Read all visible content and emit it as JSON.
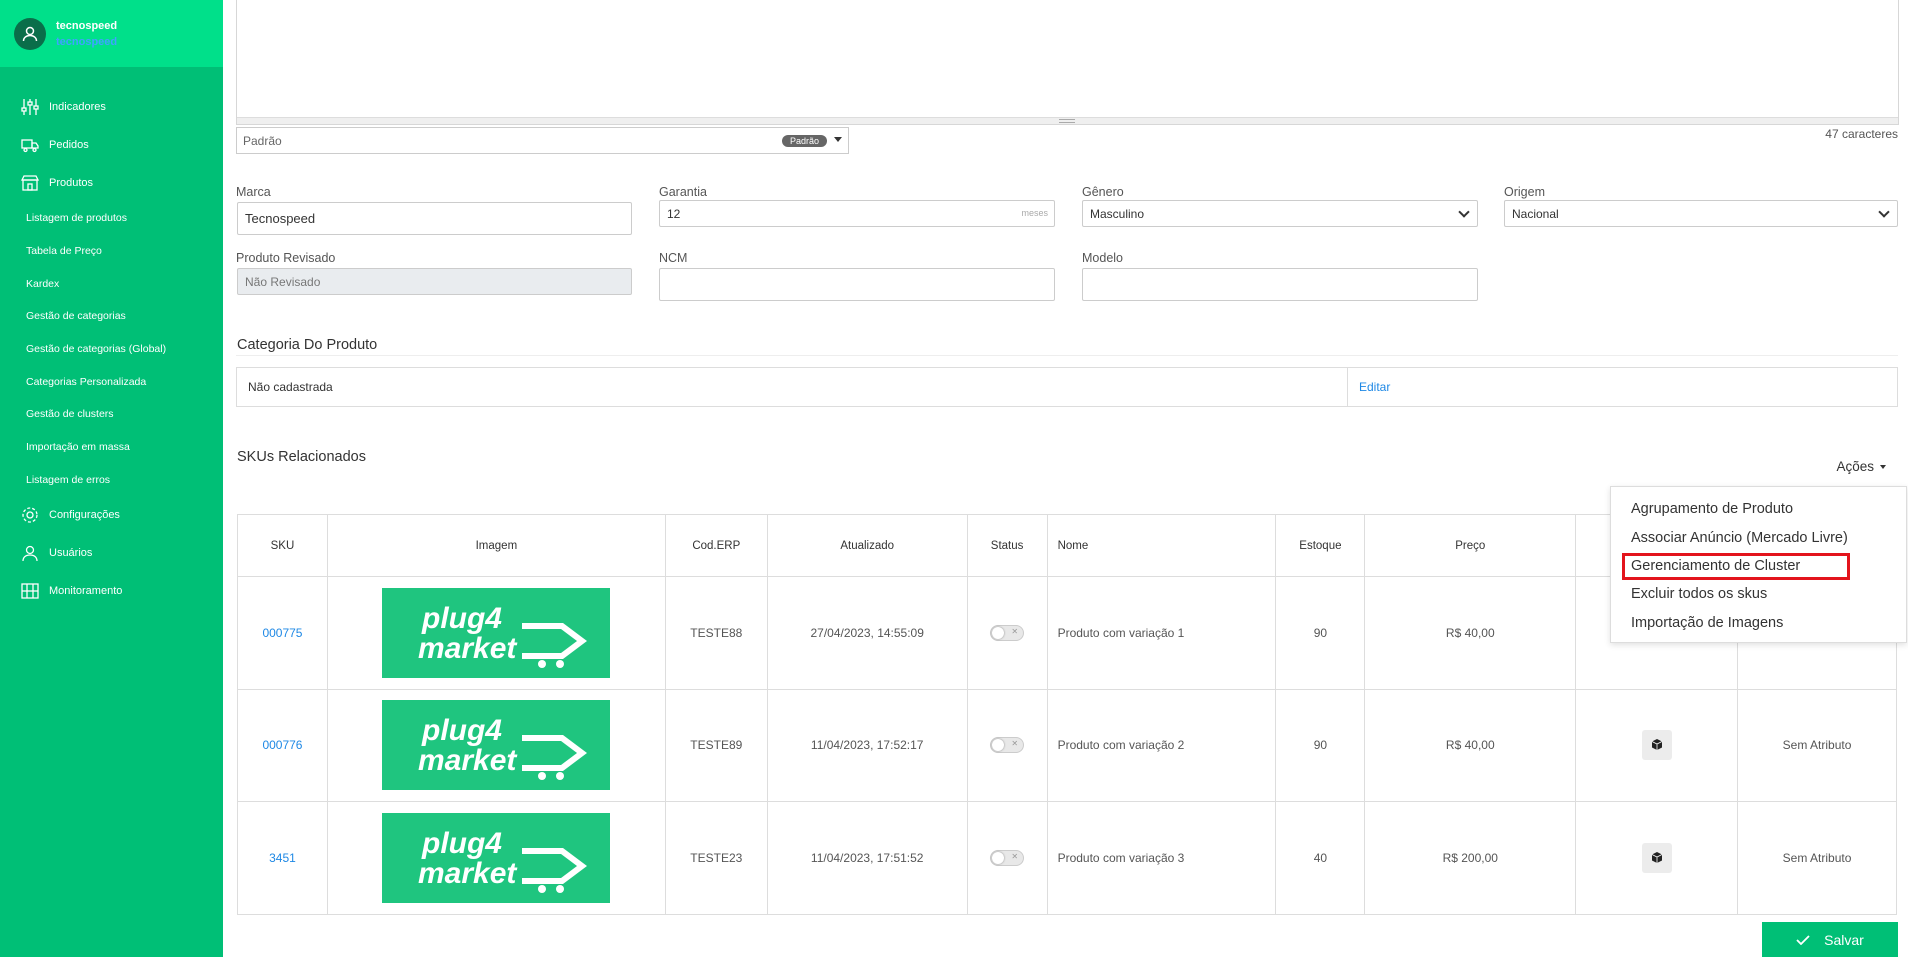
{
  "user": {
    "name": "tecnospeed",
    "sub": "tecnospeed"
  },
  "nav": {
    "indicadores": "Indicadores",
    "pedidos": "Pedidos",
    "produtos": "Produtos",
    "produtos_sub": [
      "Listagem de produtos",
      "Tabela de Preço",
      "Kardex",
      "Gestão de categorias",
      "Gestão de categorias (Global)",
      "Categorias Personalizada",
      "Gestão de clusters",
      "Importação em massa",
      "Listagem de erros"
    ],
    "configuracoes": "Configurações",
    "usuarios": "Usuários",
    "monitoramento": "Monitoramento"
  },
  "editor": {
    "template_value": "Padrão",
    "template_badge": "Padrão",
    "char_count": "47 caracteres"
  },
  "fields": {
    "marca_label": "Marca",
    "marca_value": "Tecnospeed",
    "garantia_label": "Garantia",
    "garantia_value": "12",
    "garantia_unit": "meses",
    "genero_label": "Gênero",
    "genero_value": "Masculino",
    "origem_label": "Origem",
    "origem_value": "Nacional",
    "revisado_label": "Produto Revisado",
    "revisado_value": "Não Revisado",
    "ncm_label": "NCM",
    "ncm_value": "",
    "modelo_label": "Modelo",
    "modelo_value": ""
  },
  "categoria": {
    "title": "Categoria Do Produto",
    "value": "Não cadastrada",
    "edit_link": "Editar"
  },
  "skus": {
    "title": "SKUs Relacionados",
    "actions_label": "Ações",
    "columns": [
      "SKU",
      "Imagem",
      "Cod.ERP",
      "Atualizado",
      "Status",
      "Nome",
      "Estoque",
      "Preço",
      "",
      ""
    ],
    "rows": [
      {
        "sku": "000775",
        "erp": "TESTE88",
        "updated": "27/04/2023, 14:55:09",
        "name": "Produto com variação 1",
        "stock": "90",
        "price": "R$ 40,00",
        "attr": ""
      },
      {
        "sku": "000776",
        "erp": "TESTE89",
        "updated": "11/04/2023, 17:52:17",
        "name": "Produto com variação 2",
        "stock": "90",
        "price": "R$ 40,00",
        "attr": "Sem Atributo"
      },
      {
        "sku": "3451",
        "erp": "TESTE23",
        "updated": "11/04/2023, 17:51:52",
        "name": "Produto com variação 3",
        "stock": "40",
        "price": "R$ 200,00",
        "attr": "Sem Atributo"
      }
    ]
  },
  "dropdown": [
    "Agrupamento de Produto",
    "Associar Anúncio (Mercado Livre)",
    "Gerenciamento de Cluster",
    "Excluir todos os skus",
    "Importação de Imagens"
  ],
  "save_label": "Salvar",
  "colors": {
    "primary": "#00bf76",
    "header": "#00e08a",
    "link": "#1e88e5",
    "highlight": "#e3141c"
  }
}
